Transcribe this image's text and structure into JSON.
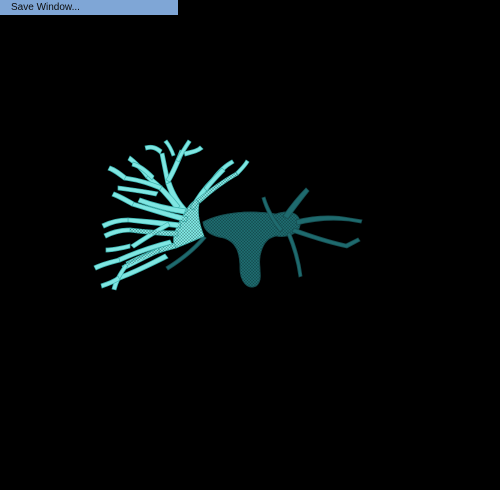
{
  "toolbar": {
    "save_window_label": "Save Window..."
  },
  "viewport": {
    "background_color": "#000000",
    "mesh_color_light": "#7fe9e6",
    "mesh_color_dark": "#1f6f72",
    "object": "vessel-mesh-3d-render"
  },
  "colors": {
    "button_background": "#7fa6d6"
  }
}
